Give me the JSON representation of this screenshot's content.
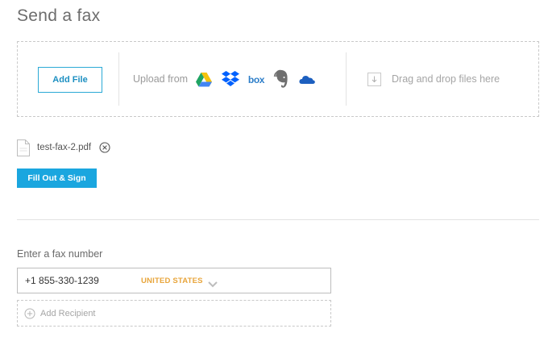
{
  "page": {
    "title": "Send a fax"
  },
  "upload": {
    "add_file_label": "Add File",
    "upload_from_label": "Upload from",
    "services": [
      {
        "name": "google-drive-icon"
      },
      {
        "name": "dropbox-icon"
      },
      {
        "name": "box-icon",
        "text": "box"
      },
      {
        "name": "evernote-icon"
      },
      {
        "name": "onedrive-icon"
      }
    ],
    "drag_drop_label": "Drag and drop files here"
  },
  "file": {
    "name": "test-fax-2.pdf",
    "sign_label": "Fill Out & Sign"
  },
  "recipient": {
    "label": "Enter a fax number",
    "fax_number": "+1 855-330-1239",
    "country": "UNITED STATES",
    "add_recipient_label": "Add Recipient"
  },
  "colors": {
    "accent": "#1aa6df",
    "country": "#e8a53b",
    "border": "#c9c9c9"
  }
}
